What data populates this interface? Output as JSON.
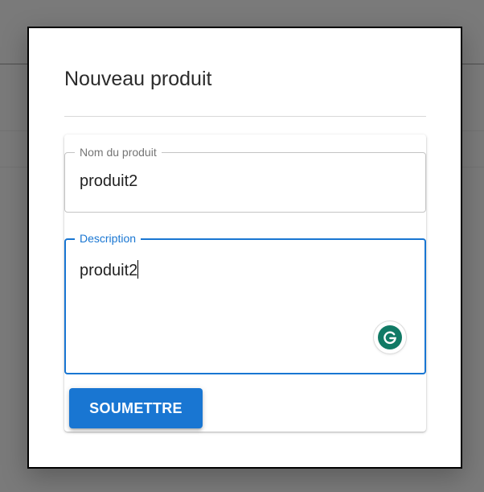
{
  "dialog": {
    "title": "Nouveau produit"
  },
  "form": {
    "name_field": {
      "label": "Nom du produit",
      "value": "produit2"
    },
    "description_field": {
      "label": "Description",
      "value": "produit2",
      "focused": true
    },
    "submit_label": "SOUMETTRE"
  },
  "icons": {
    "grammarly": "grammarly-icon"
  },
  "colors": {
    "accent": "#1976d2",
    "grammarly": "#117a65",
    "overlay": "#7a7a7a"
  }
}
